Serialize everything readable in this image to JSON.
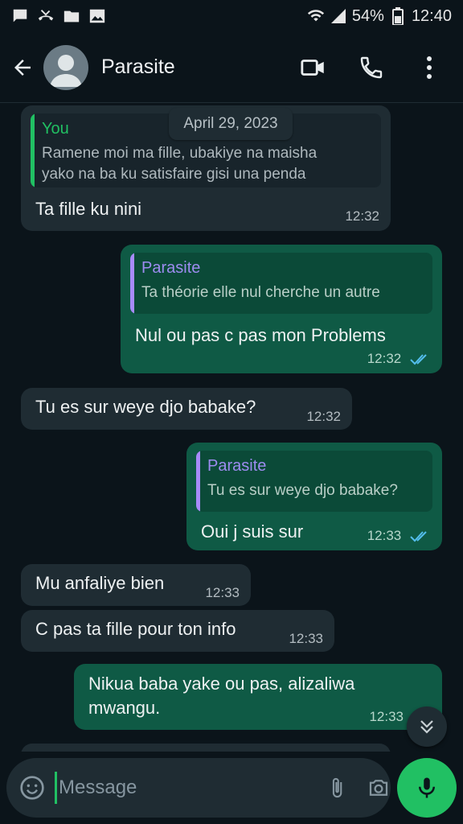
{
  "status_bar": {
    "battery": "54%",
    "time": "12:40"
  },
  "header": {
    "contact_name": "Parasite",
    "icons": [
      "back-arrow-icon",
      "avatar",
      "video-call-icon",
      "phone-icon",
      "more-vert-icon"
    ]
  },
  "date_chip": "April 29, 2023",
  "messages": [
    {
      "direction": "in",
      "quote_author": "You",
      "quote_text_line1": "Ramene moi ma fille, ubakiye na maisha",
      "quote_text_line2": "yako na ba ku satisfaire gisi una penda",
      "text": "Ta fille ku nini",
      "time": "12:32"
    },
    {
      "direction": "out",
      "quote_author": "Parasite",
      "quote_text": "Ta théorie elle nul cherche un autre",
      "text": "Nul ou pas c pas mon Problems",
      "time": "12:32",
      "read": true
    },
    {
      "direction": "in",
      "text": "Tu es sur weye djo babake?",
      "time": "12:32"
    },
    {
      "direction": "out",
      "quote_author": "Parasite",
      "quote_text": "Tu es sur weye djo babake?",
      "text": "Oui j suis sur",
      "time": "12:33",
      "read": true
    },
    {
      "direction": "in",
      "text": "Mu anfaliye bien",
      "time": "12:33"
    },
    {
      "direction": "in",
      "text": "C pas ta fille pour ton info",
      "time": "12:33"
    },
    {
      "direction": "out",
      "text_line1": "Nikua baba yake ou pas, alizaliwa",
      "text_line2": "mwangu.",
      "time": "12:33"
    }
  ],
  "input": {
    "placeholder": "Message"
  },
  "colors": {
    "background": "#0b141a",
    "incoming_bubble": "#1f2c33",
    "outgoing_bubble": "#0f5a45",
    "accent_green": "#21c063",
    "read_ticks": "#53bdeb",
    "quote_parasite": "#9d8cf0"
  }
}
